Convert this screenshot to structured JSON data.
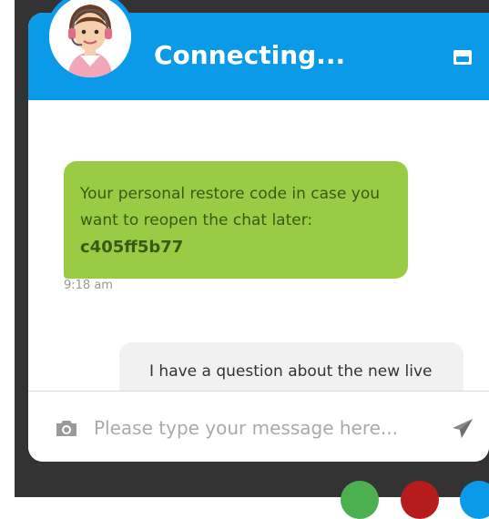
{
  "header": {
    "title": "Connecting..."
  },
  "messages": {
    "agent": {
      "text": "Your personal restore code in case you want to reopen the chat later:",
      "code": "c405ff5b77",
      "time": "9:18 am"
    },
    "user": {
      "text": "I have a question about the new live"
    }
  },
  "input": {
    "placeholder": "Please type your message here..."
  },
  "colors": {
    "header": "#0a9ae8",
    "agent_bubble": "#99cc44",
    "user_bubble": "#f1f1f1",
    "background": "#333333"
  }
}
